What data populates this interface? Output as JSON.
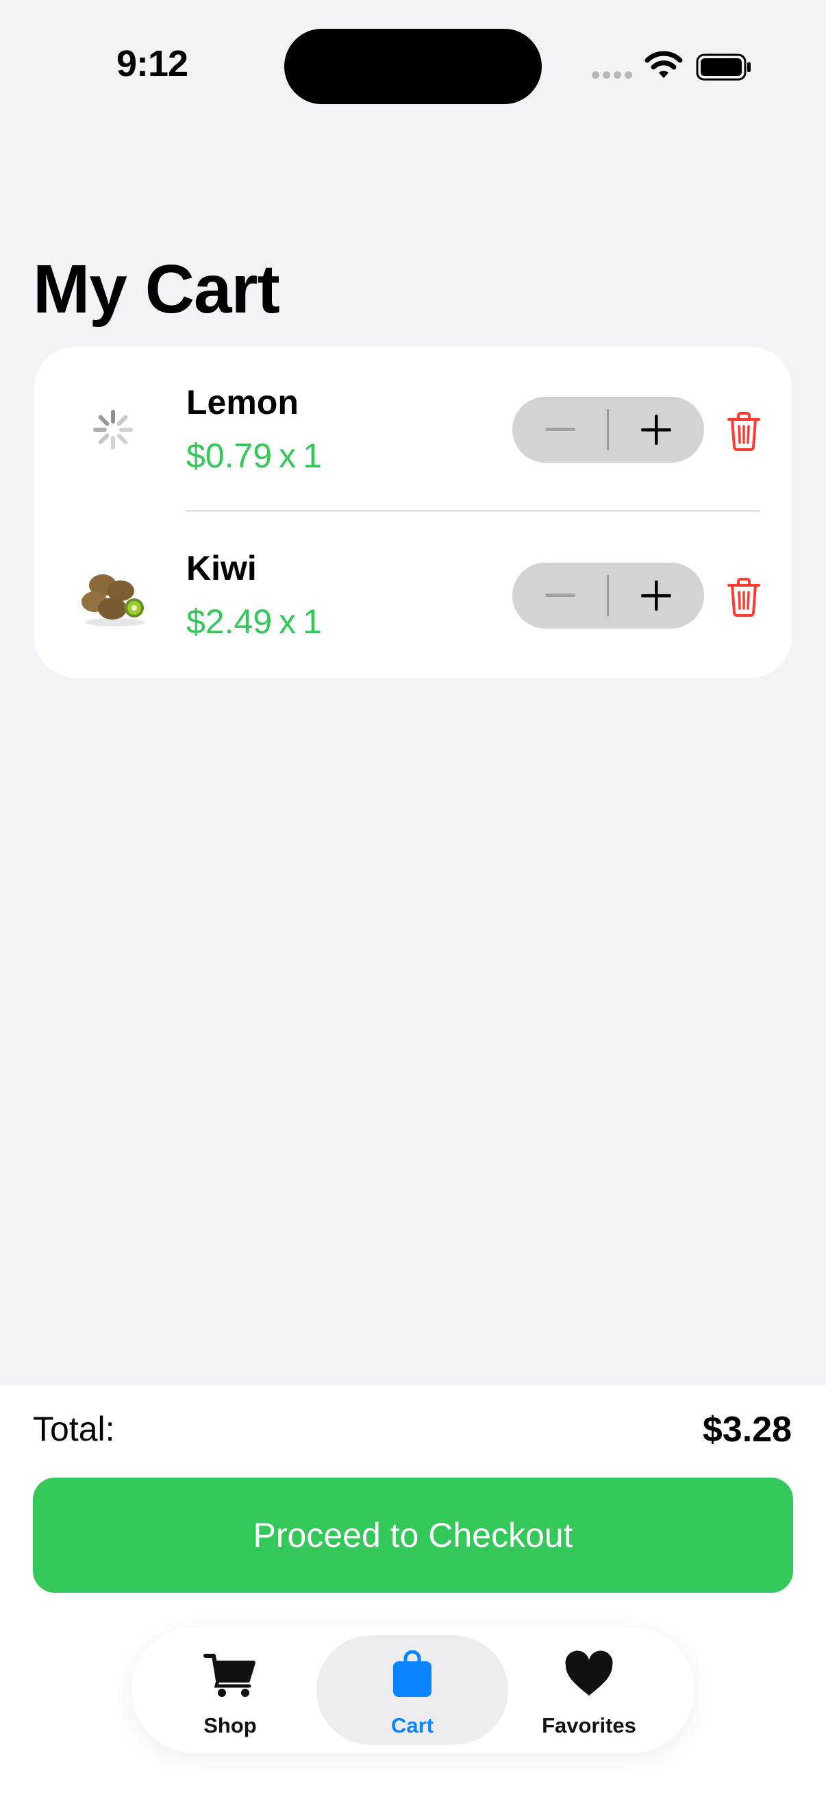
{
  "status_bar": {
    "time": "9:12"
  },
  "page": {
    "title": "My Cart"
  },
  "cart": {
    "items": [
      {
        "name": "Lemon",
        "price": "$0.79",
        "x": "x",
        "quantity": "1",
        "image": "loading-spinner-icon"
      },
      {
        "name": "Kiwi",
        "price": "$2.49",
        "x": "x",
        "quantity": "1",
        "image": "kiwi-image"
      }
    ]
  },
  "summary": {
    "total_label": "Total:",
    "total_value": "$3.28"
  },
  "checkout": {
    "label": "Proceed to Checkout"
  },
  "tab_bar": {
    "tabs": [
      {
        "label": "Shop",
        "icon": "cart-icon"
      },
      {
        "label": "Cart",
        "icon": "bag-icon",
        "selected": true
      },
      {
        "label": "Favorites",
        "icon": "heart-icon"
      }
    ]
  },
  "colors": {
    "accent_green": "#34C759",
    "selected_blue": "#0A84FF",
    "delete_red": "#FF3B30",
    "background": "#F2F2F7"
  }
}
